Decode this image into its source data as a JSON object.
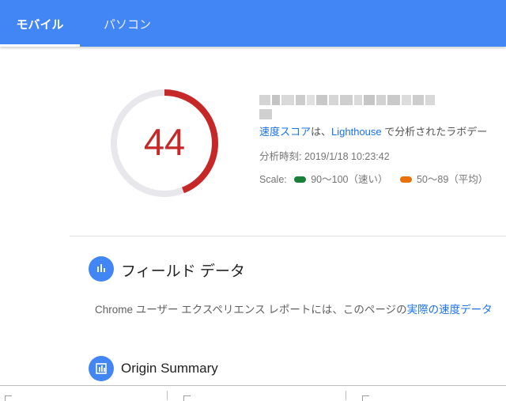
{
  "tabs": [
    {
      "label": "モバイル",
      "active": true
    },
    {
      "label": "パソコン",
      "active": false
    }
  ],
  "score": {
    "value": "44",
    "fraction": 0.44,
    "color": "#c62828",
    "track_color": "#e8e8ec"
  },
  "summary": {
    "speed_score_link": "速度スコア",
    "text_ha": "は、",
    "lighthouse_link": "Lighthouse",
    "text_rest": " で分析されたラボデー",
    "analysis_time": "分析時刻: 2019/1/18 10:23:42",
    "scale_label": "Scale:",
    "scale_fast": "90～100（速い）",
    "scale_average": "50～89（平均）",
    "fast_color": "#188038",
    "average_color": "#e8710a"
  },
  "field_data": {
    "title": "フィールド データ",
    "description_prefix": "Chrome ユーザー エクスペリエンス レポートには、このページの",
    "description_link": "実際の速度データ",
    "icon": "bar-chart-icon"
  },
  "origin_summary": {
    "title": "Origin Summary",
    "icon": "summary-chart-icon"
  },
  "colors": {
    "brand": "#4285f4",
    "link": "#1a73e8"
  }
}
